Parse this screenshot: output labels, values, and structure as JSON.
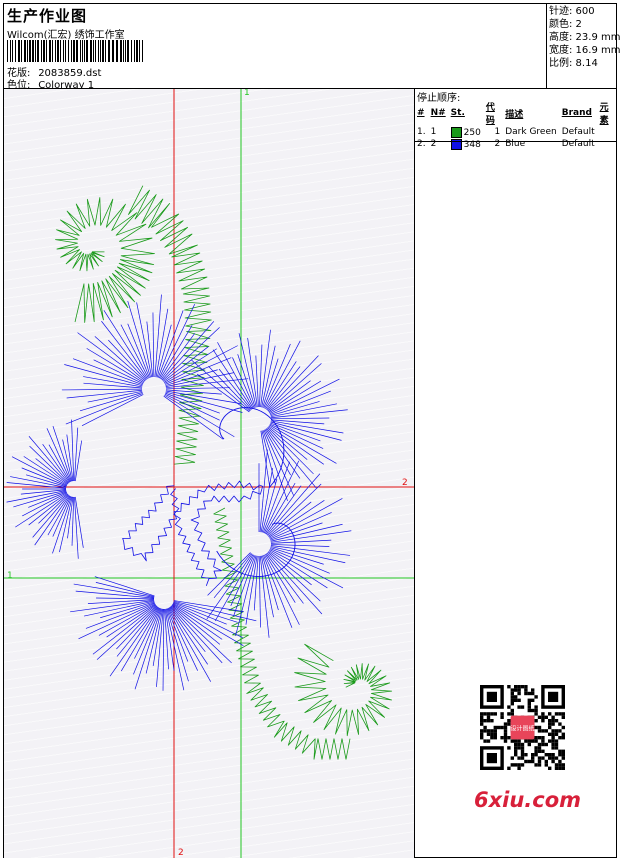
{
  "header": {
    "title": "生产作业图",
    "subtitle": "Wilcom(汇宏) 绣饰工作室",
    "design_label": "花版:",
    "design_value": "2083859.dst",
    "colorway_label": "色位:",
    "colorway_value": "Colorway 1"
  },
  "stats": {
    "stitches": "针迹: 600",
    "colors": "颜色: 2",
    "height": "高度: 23.9 mm",
    "width": "宽度: 16.9 mm",
    "scale": "比例: 8.14"
  },
  "sequence": {
    "title": "停止顺序:",
    "headers": [
      "#",
      "N#",
      "St.",
      "代码",
      "描述",
      "Brand",
      "元素"
    ],
    "rows": [
      {
        "idx": "1.",
        "n": "1",
        "swatch": "#1a9a1a",
        "st": "250",
        "code": "1",
        "desc": "Dark Green",
        "brand": "Default",
        "elem": ""
      },
      {
        "idx": "2.",
        "n": "2",
        "swatch": "#1010e6",
        "st": "348",
        "code": "2",
        "desc": "Blue",
        "brand": "Default",
        "elem": ""
      }
    ]
  },
  "axes": {
    "green_top": "1",
    "green_left": "1",
    "red_right": "2",
    "red_bottom": "2"
  },
  "colors": {
    "thread_green": "#1a9a1a",
    "thread_blue": "#1010e6",
    "guide_green": "#22c522",
    "guide_red": "#e01010"
  },
  "watermark": "6xiu.com",
  "qr_badge": "设计图纸"
}
